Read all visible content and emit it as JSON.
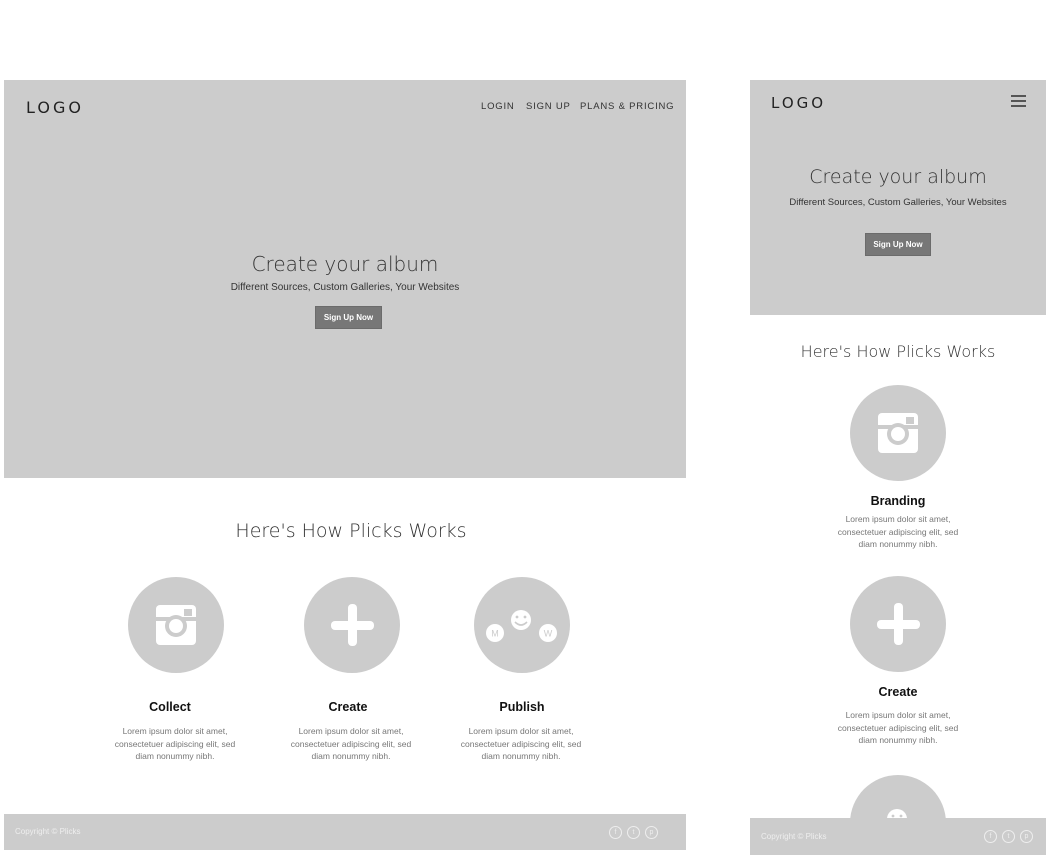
{
  "desktop": {
    "logo": "LOGO",
    "nav": [
      "LOGIN",
      "SIGN UP",
      "PLANS & PRICING"
    ],
    "hero_title": "Create your album",
    "hero_subtitle": "Different Sources, Custom Galleries, Your Websites",
    "cta": "Sign Up Now",
    "how_title": "Here's How Plicks Works",
    "features": [
      {
        "icon": "instagram-icon",
        "title": "Collect",
        "desc": "Lorem ipsum dolor sit amet, consectetuer adipiscing elit, sed diam nonummy nibh."
      },
      {
        "icon": "plus-icon",
        "title": "Create",
        "desc": "Lorem ipsum dolor sit amet, consectetuer adipiscing elit, sed diam nonummy nibh."
      },
      {
        "icon": "publish-icon",
        "title": "Publish",
        "desc": "Lorem ipsum dolor sit amet, consectetuer adipiscing elit, sed diam nonummy nibh."
      }
    ],
    "publish_badges": [
      "M",
      "W"
    ],
    "copyright": "Copyright © Plicks",
    "social": [
      "f",
      "t",
      "p"
    ]
  },
  "mobile": {
    "logo": "LOGO",
    "hero_title": "Create your album",
    "hero_subtitle": "Different Sources, Custom Galleries, Your Websites",
    "cta": "Sign Up Now",
    "how_title": "Here's How Plicks Works",
    "features": [
      {
        "icon": "instagram-icon",
        "title": "Branding",
        "desc": "Lorem ipsum dolor sit amet, consectetuer adipiscing elit, sed diam nonummy nibh."
      },
      {
        "icon": "plus-icon",
        "title": "Create",
        "desc": "Lorem ipsum dolor sit amet, consectetuer adipiscing elit, sed diam nonummy nibh."
      },
      {
        "icon": "smiley-icon",
        "title": "",
        "desc": ""
      }
    ],
    "copyright": "Copyright © Plicks",
    "social": [
      "f",
      "t",
      "p"
    ]
  },
  "colors": {
    "hero_bg": "#cccccc",
    "button_bg": "#777777",
    "footer_bg": "#cccccc",
    "muted_text": "#777777"
  }
}
